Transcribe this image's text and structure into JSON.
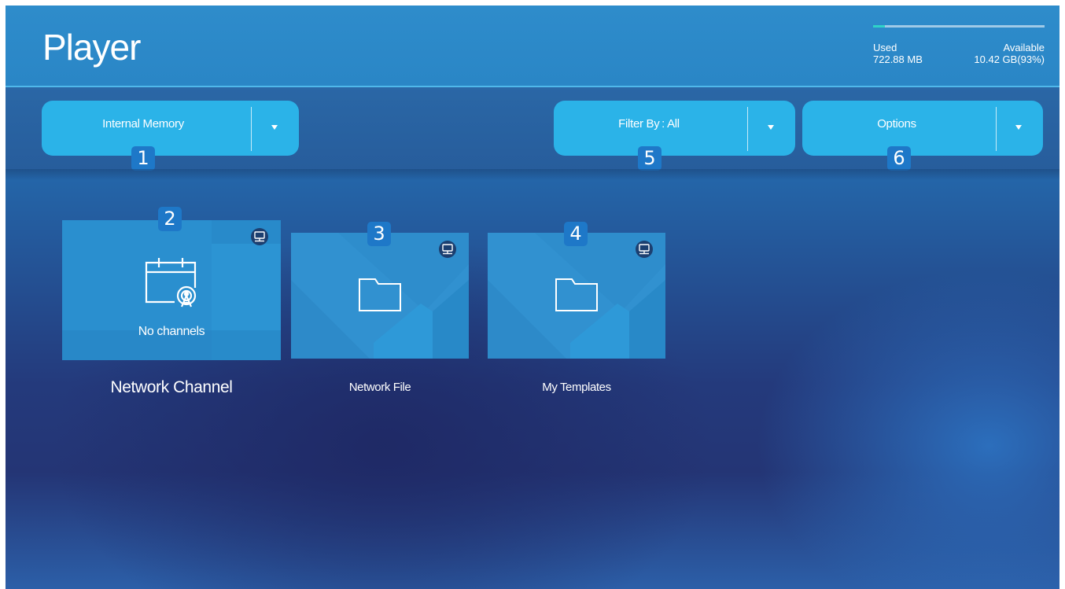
{
  "header": {
    "title": "Player",
    "storage": {
      "used_label": "Used",
      "used_value": "722.88 MB",
      "available_label": "Available",
      "available_value": "10.42 GB(93%)",
      "used_fraction": 0.07
    }
  },
  "toolbar": {
    "storage_dropdown": {
      "label": "Internal Memory",
      "badge": "1"
    },
    "filter_dropdown": {
      "label": "Filter By : All",
      "badge": "5"
    },
    "options_dropdown": {
      "label": "Options",
      "badge": "6"
    }
  },
  "tiles": [
    {
      "label": "Network Channel",
      "status": "No channels",
      "badge": "2",
      "icon": "calendar-broadcast-icon"
    },
    {
      "label": "Network File",
      "badge": "3",
      "icon": "folder-icon"
    },
    {
      "label": "My Templates",
      "badge": "4",
      "icon": "folder-icon"
    }
  ],
  "colors": {
    "header": "#2e8ccb",
    "dropdown": "#2bb3e8",
    "badge": "#1e78c8",
    "storage_fill": "#2fd3c8",
    "tile": "#2a8fcf"
  }
}
